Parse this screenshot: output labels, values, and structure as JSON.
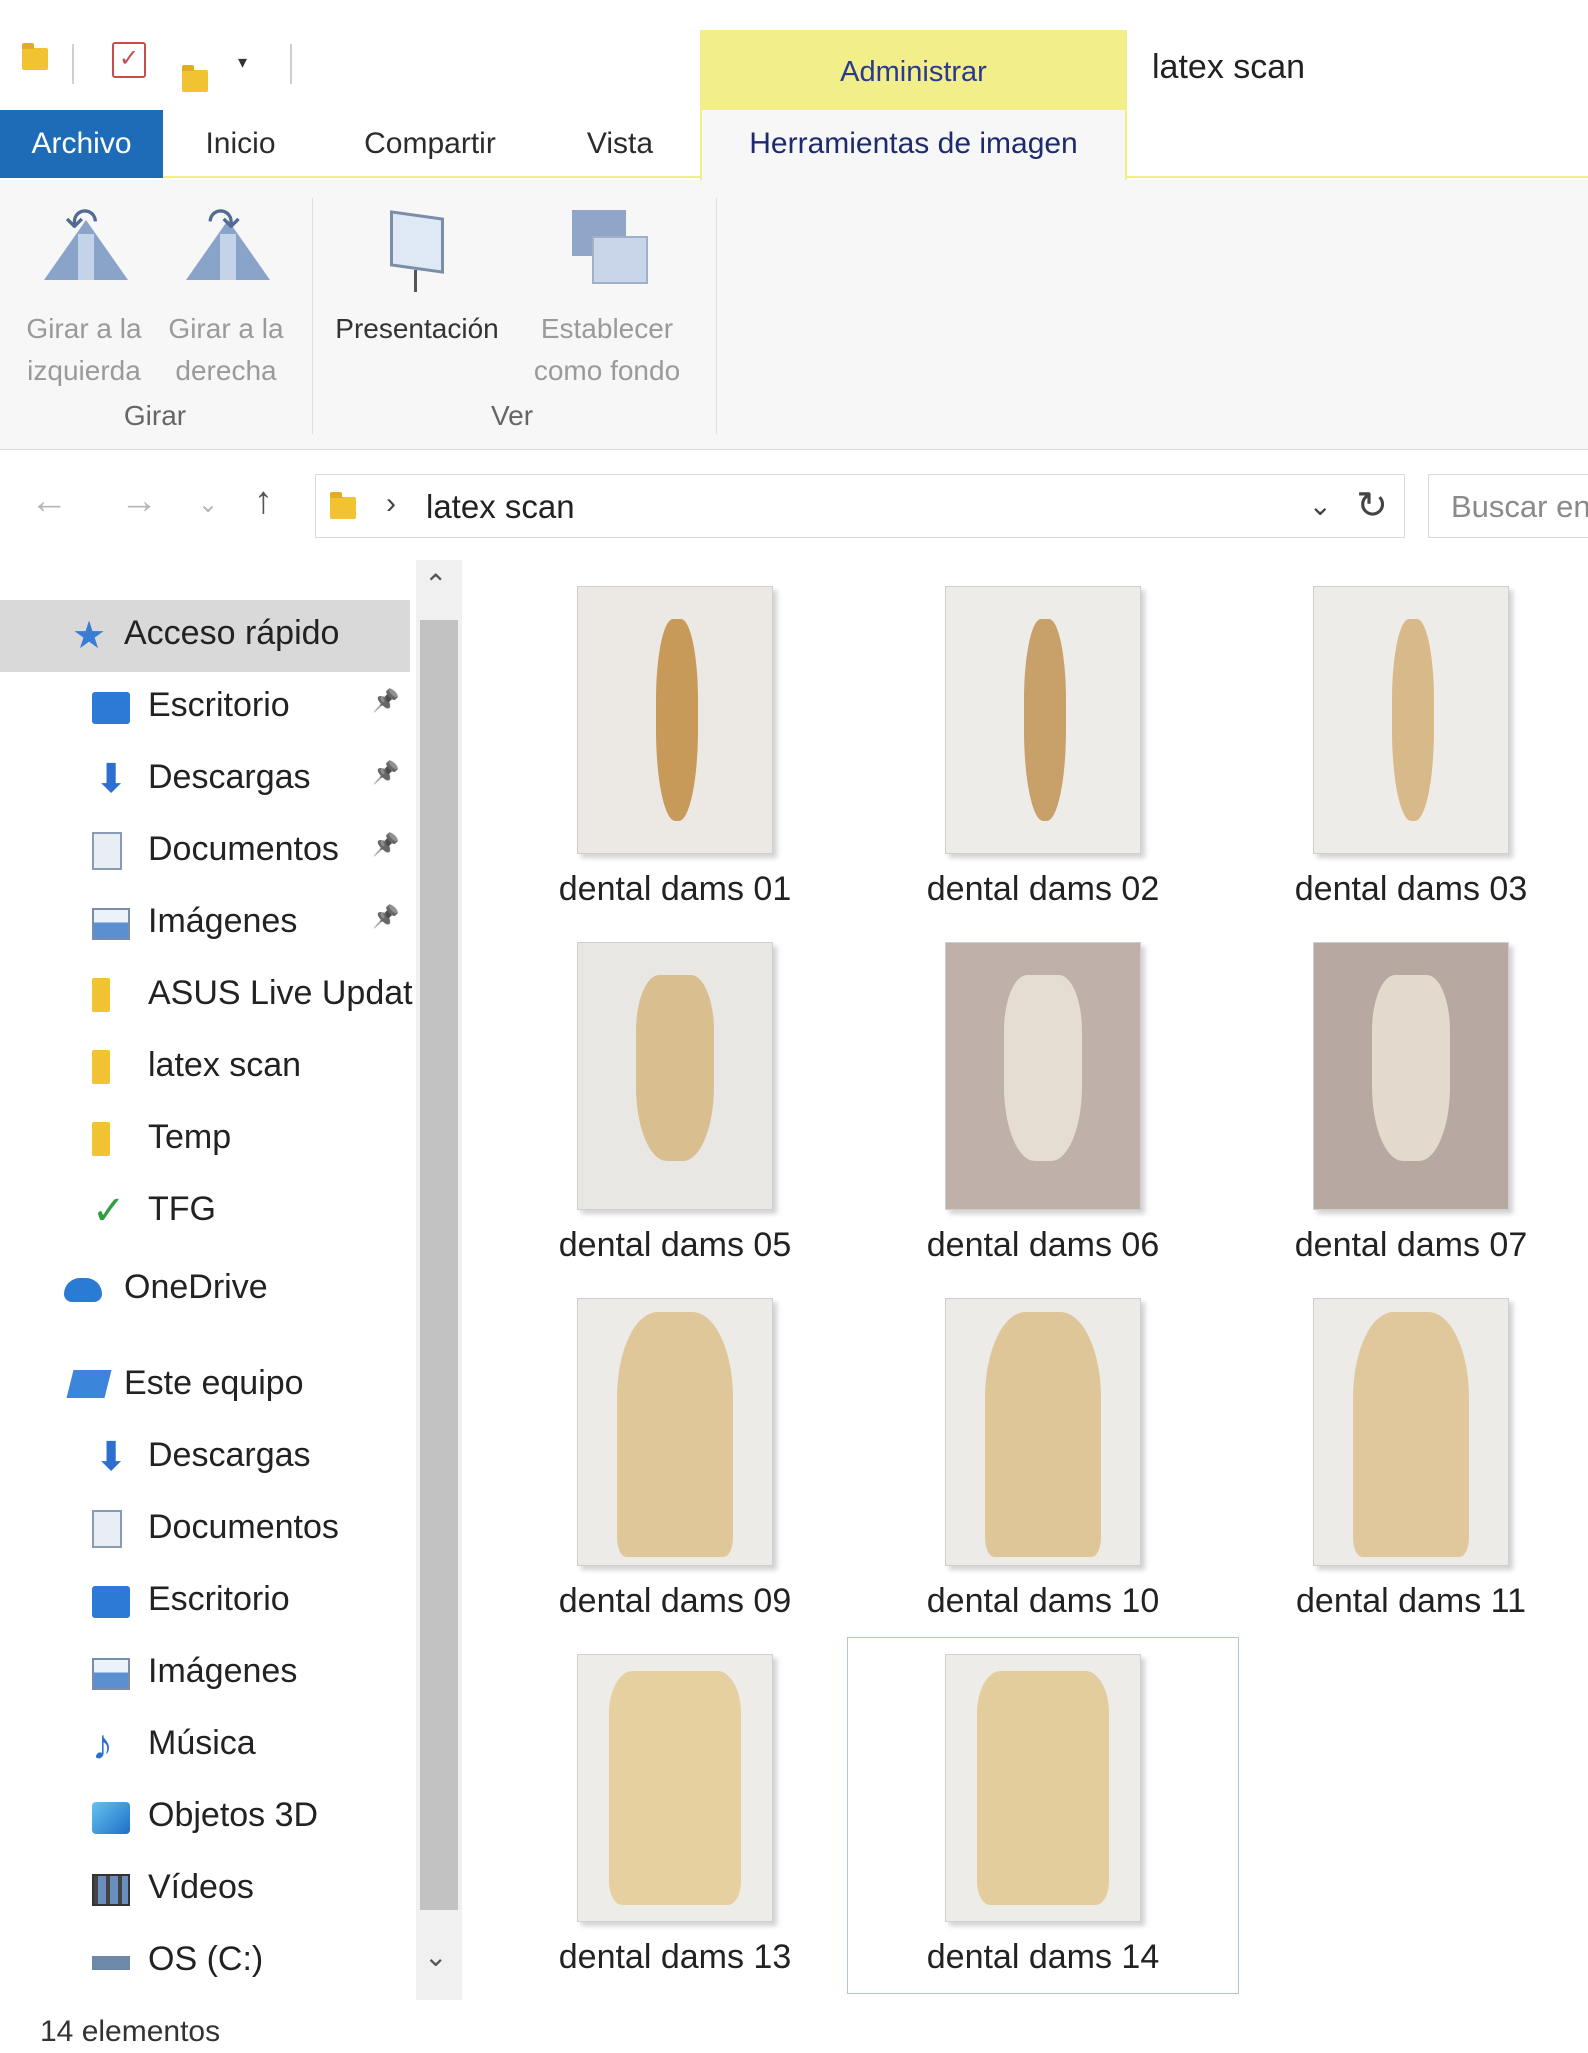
{
  "window": {
    "title": "latex scan",
    "context_tab_group": "Administrar"
  },
  "ribbon": {
    "tabs": [
      {
        "label": "Archivo"
      },
      {
        "label": "Inicio"
      },
      {
        "label": "Compartir"
      },
      {
        "label": "Vista"
      },
      {
        "label": "Herramientas de imagen"
      }
    ],
    "groups": {
      "girar": {
        "label": "Girar",
        "rotate_left": {
          "line1": "Girar a la",
          "line2": "izquierda"
        },
        "rotate_right": {
          "line1": "Girar a la",
          "line2": "derecha"
        }
      },
      "ver": {
        "label": "Ver",
        "slideshow": {
          "line1": "Presentación"
        },
        "set_background": {
          "line1": "Establecer",
          "line2": "como fondo"
        }
      }
    }
  },
  "address_bar": {
    "breadcrumb": "latex scan",
    "search_placeholder": "Buscar en"
  },
  "nav_pane": {
    "quick_access": "Acceso rápido",
    "quick_items": [
      {
        "label": "Escritorio",
        "icon": "desktop-icon",
        "pinned": true
      },
      {
        "label": "Descargas",
        "icon": "downloads-icon",
        "pinned": true
      },
      {
        "label": "Documentos",
        "icon": "documents-icon",
        "pinned": true
      },
      {
        "label": "Imágenes",
        "icon": "pictures-icon",
        "pinned": true
      },
      {
        "label": "ASUS Live Updat",
        "icon": "folder-icon",
        "pinned": false
      },
      {
        "label": "latex scan",
        "icon": "folder-icon",
        "pinned": false
      },
      {
        "label": "Temp",
        "icon": "folder-icon",
        "pinned": false
      },
      {
        "label": "TFG",
        "icon": "check-icon",
        "pinned": false
      }
    ],
    "onedrive": "OneDrive",
    "this_pc": "Este equipo",
    "pc_items": [
      {
        "label": "Descargas",
        "icon": "downloads-icon"
      },
      {
        "label": "Documentos",
        "icon": "documents-icon"
      },
      {
        "label": "Escritorio",
        "icon": "desktop-icon"
      },
      {
        "label": "Imágenes",
        "icon": "pictures-icon"
      },
      {
        "label": "Música",
        "icon": "music-icon"
      },
      {
        "label": "Objetos 3D",
        "icon": "objects-3d-icon"
      },
      {
        "label": "Vídeos",
        "icon": "videos-icon"
      },
      {
        "label": "OS (C:)",
        "icon": "drive-icon"
      }
    ]
  },
  "files": [
    {
      "name": "dental dams 01",
      "bg": "#ece9e4",
      "obj": "#c79a5a"
    },
    {
      "name": "dental dams 02",
      "bg": "#eeece8",
      "obj": "#c8a06a"
    },
    {
      "name": "dental dams 03",
      "bg": "#eeece8",
      "obj": "#d8b98a"
    },
    {
      "name": "dental dams 05",
      "bg": "#e9e7e3",
      "obj": "#d9bf8f"
    },
    {
      "name": "dental dams 06",
      "bg": "#bfb0aa",
      "obj": "#e6ddd2"
    },
    {
      "name": "dental dams 07",
      "bg": "#b7a8a2",
      "obj": "#e3d9cc"
    },
    {
      "name": "dental dams 09",
      "bg": "#ecebe8",
      "obj": "#e0c79a"
    },
    {
      "name": "dental dams 10",
      "bg": "#ecebe8",
      "obj": "#dfc699"
    },
    {
      "name": "dental dams 11",
      "bg": "#ecebe8",
      "obj": "#e0c89c"
    },
    {
      "name": "dental dams 13",
      "bg": "#edece9",
      "obj": "#e6d09f"
    },
    {
      "name": "dental dams 14",
      "bg": "#edece9",
      "obj": "#e3cd9d"
    }
  ],
  "status": {
    "item_count": "14 elementos"
  }
}
